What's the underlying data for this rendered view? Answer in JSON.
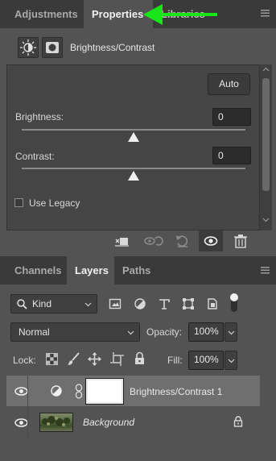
{
  "top_tabs": [
    "Adjustments",
    "Properties",
    "Libraries"
  ],
  "properties": {
    "title": "Brightness/Contrast",
    "auto_label": "Auto",
    "brightness_label": "Brightness:",
    "brightness_value": "0",
    "contrast_label": "Contrast:",
    "contrast_value": "0",
    "use_legacy_label": "Use Legacy",
    "use_legacy_checked": false
  },
  "bottom_tabs": [
    "Channels",
    "Layers",
    "Paths"
  ],
  "layers_panel": {
    "filter_kind": "Kind",
    "blend_mode": "Normal",
    "opacity_label": "Opacity:",
    "opacity_value": "100%",
    "lock_label": "Lock:",
    "fill_label": "Fill:",
    "fill_value": "100%",
    "layers": [
      {
        "name": "Brightness/Contrast 1",
        "selected": true,
        "visible": true
      },
      {
        "name": "Background",
        "selected": false,
        "visible": true,
        "locked": true
      }
    ]
  },
  "colors": {
    "panel_bg": "#535353",
    "tabbar_bg": "#3a3a3a",
    "selected_layer_bg": "#6f6f6f",
    "annotation_arrow": "#19e619"
  },
  "annotation": {
    "arrow_points_to": "Properties"
  }
}
